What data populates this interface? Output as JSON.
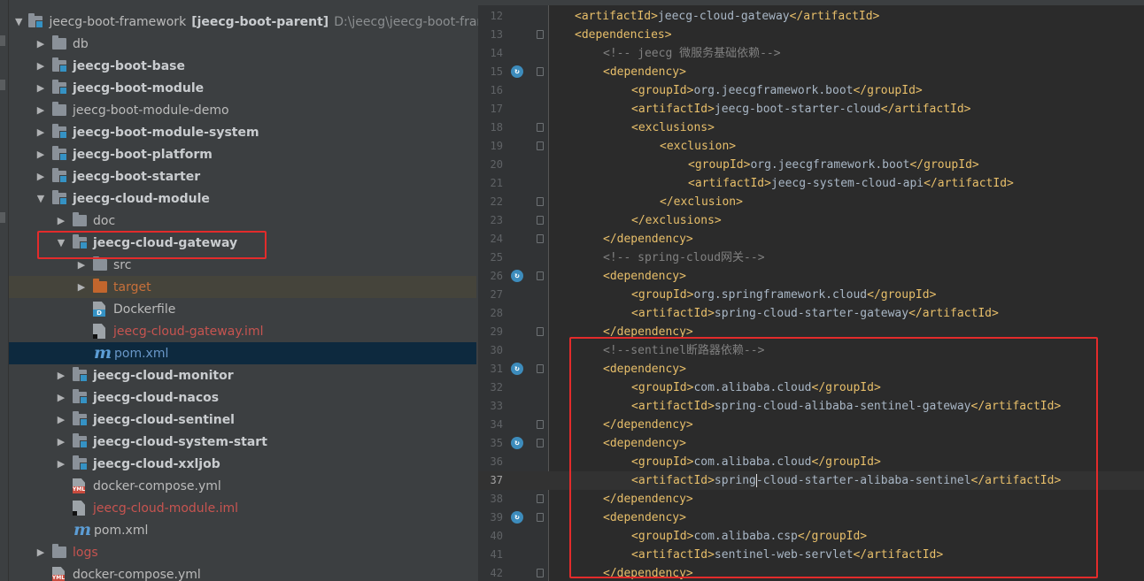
{
  "project_tree": {
    "rows": [
      {
        "label": "jeecg-boot-framework",
        "suffix": "[jeecg-boot-parent]",
        "hint": "D:\\jeecg\\jeecg-boot-frame"
      },
      {
        "label": "db"
      },
      {
        "label": "jeecg-boot-base"
      },
      {
        "label": "jeecg-boot-module"
      },
      {
        "label": "jeecg-boot-module-demo"
      },
      {
        "label": "jeecg-boot-module-system"
      },
      {
        "label": "jeecg-boot-platform"
      },
      {
        "label": "jeecg-boot-starter"
      },
      {
        "label": "jeecg-cloud-module"
      },
      {
        "label": "doc"
      },
      {
        "label": "jeecg-cloud-gateway"
      },
      {
        "label": "src"
      },
      {
        "label": "target"
      },
      {
        "label": "Dockerfile"
      },
      {
        "label": "jeecg-cloud-gateway.iml"
      },
      {
        "label": "pom.xml"
      },
      {
        "label": "jeecg-cloud-monitor"
      },
      {
        "label": "jeecg-cloud-nacos"
      },
      {
        "label": "jeecg-cloud-sentinel"
      },
      {
        "label": "jeecg-cloud-system-start"
      },
      {
        "label": "jeecg-cloud-xxljob"
      },
      {
        "label": "docker-compose.yml"
      },
      {
        "label": "jeecg-cloud-module.iml"
      },
      {
        "label": "pom.xml"
      },
      {
        "label": "logs"
      },
      {
        "label": "docker-compose.yml"
      }
    ]
  },
  "editor": {
    "lines": [
      {
        "n": "12",
        "code": [
          [
            "tag",
            "<artifactId>"
          ],
          [
            "txt",
            "jeecg-cloud-gateway"
          ],
          [
            "tag",
            "</artifactId>"
          ]
        ]
      },
      {
        "n": "13",
        "code": [
          [
            "tag",
            "<dependencies>"
          ]
        ]
      },
      {
        "n": "14",
        "code": [
          [
            "cmt",
            "<!-- jeecg 微服务基础依赖-->"
          ]
        ]
      },
      {
        "n": "15",
        "code": [
          [
            "tag",
            "<dependency>"
          ]
        ]
      },
      {
        "n": "16",
        "code": [
          [
            "tag",
            "<groupId>"
          ],
          [
            "txt",
            "org.jeecgframework.boot"
          ],
          [
            "tag",
            "</groupId>"
          ]
        ]
      },
      {
        "n": "17",
        "code": [
          [
            "tag",
            "<artifactId>"
          ],
          [
            "txt",
            "jeecg-boot-starter-cloud"
          ],
          [
            "tag",
            "</artifactId>"
          ]
        ]
      },
      {
        "n": "18",
        "code": [
          [
            "tag",
            "<exclusions>"
          ]
        ]
      },
      {
        "n": "19",
        "code": [
          [
            "tag",
            "<exclusion>"
          ]
        ]
      },
      {
        "n": "20",
        "code": [
          [
            "tag",
            "<groupId>"
          ],
          [
            "txt",
            "org.jeecgframework.boot"
          ],
          [
            "tag",
            "</groupId>"
          ]
        ]
      },
      {
        "n": "21",
        "code": [
          [
            "tag",
            "<artifactId>"
          ],
          [
            "txt",
            "jeecg-system-cloud-api"
          ],
          [
            "tag",
            "</artifactId>"
          ]
        ]
      },
      {
        "n": "22",
        "code": [
          [
            "tag",
            "</exclusion>"
          ]
        ]
      },
      {
        "n": "23",
        "code": [
          [
            "tag",
            "</exclusions>"
          ]
        ]
      },
      {
        "n": "24",
        "code": [
          [
            "tag",
            "</dependency>"
          ]
        ]
      },
      {
        "n": "25",
        "code": [
          [
            "cmt",
            "<!-- spring-cloud网关-->"
          ]
        ]
      },
      {
        "n": "26",
        "code": [
          [
            "tag",
            "<dependency>"
          ]
        ]
      },
      {
        "n": "27",
        "code": [
          [
            "tag",
            "<groupId>"
          ],
          [
            "txt",
            "org.springframework.cloud"
          ],
          [
            "tag",
            "</groupId>"
          ]
        ]
      },
      {
        "n": "28",
        "code": [
          [
            "tag",
            "<artifactId>"
          ],
          [
            "txt",
            "spring-cloud-starter-gateway"
          ],
          [
            "tag",
            "</artifactId>"
          ]
        ]
      },
      {
        "n": "29",
        "code": [
          [
            "tag",
            "</dependency>"
          ]
        ]
      },
      {
        "n": "30",
        "code": [
          [
            "cmt",
            "<!--sentinel断路器依赖-->"
          ]
        ]
      },
      {
        "n": "31",
        "code": [
          [
            "tag",
            "<dependency>"
          ]
        ]
      },
      {
        "n": "32",
        "code": [
          [
            "tag",
            "<groupId>"
          ],
          [
            "txt",
            "com.alibaba.cloud"
          ],
          [
            "tag",
            "</groupId>"
          ]
        ]
      },
      {
        "n": "33",
        "code": [
          [
            "tag",
            "<artifactId>"
          ],
          [
            "txt",
            "spring-cloud-alibaba-sentinel-gateway"
          ],
          [
            "tag",
            "</artifactId>"
          ]
        ]
      },
      {
        "n": "34",
        "code": [
          [
            "tag",
            "</dependency>"
          ]
        ]
      },
      {
        "n": "35",
        "code": [
          [
            "tag",
            "<dependency>"
          ]
        ]
      },
      {
        "n": "36",
        "code": [
          [
            "tag",
            "<groupId>"
          ],
          [
            "txt",
            "com.alibaba.cloud"
          ],
          [
            "tag",
            "</groupId>"
          ]
        ]
      },
      {
        "n": "37",
        "code": [
          [
            "tag",
            "<artifactId>"
          ],
          [
            "txt",
            "spring-cloud-starter-alibaba-sentinel"
          ],
          [
            "tag",
            "</artifactId>"
          ]
        ]
      },
      {
        "n": "38",
        "code": [
          [
            "tag",
            "</dependency>"
          ]
        ]
      },
      {
        "n": "39",
        "code": [
          [
            "tag",
            "<dependency>"
          ]
        ]
      },
      {
        "n": "40",
        "code": [
          [
            "tag",
            "<groupId>"
          ],
          [
            "txt",
            "com.alibaba.csp"
          ],
          [
            "tag",
            "</groupId>"
          ]
        ]
      },
      {
        "n": "41",
        "code": [
          [
            "tag",
            "<artifactId>"
          ],
          [
            "txt",
            "sentinel-web-servlet"
          ],
          [
            "tag",
            "</artifactId>"
          ]
        ]
      },
      {
        "n": "42",
        "code": [
          [
            "tag",
            "</dependency>"
          ]
        ]
      }
    ]
  }
}
